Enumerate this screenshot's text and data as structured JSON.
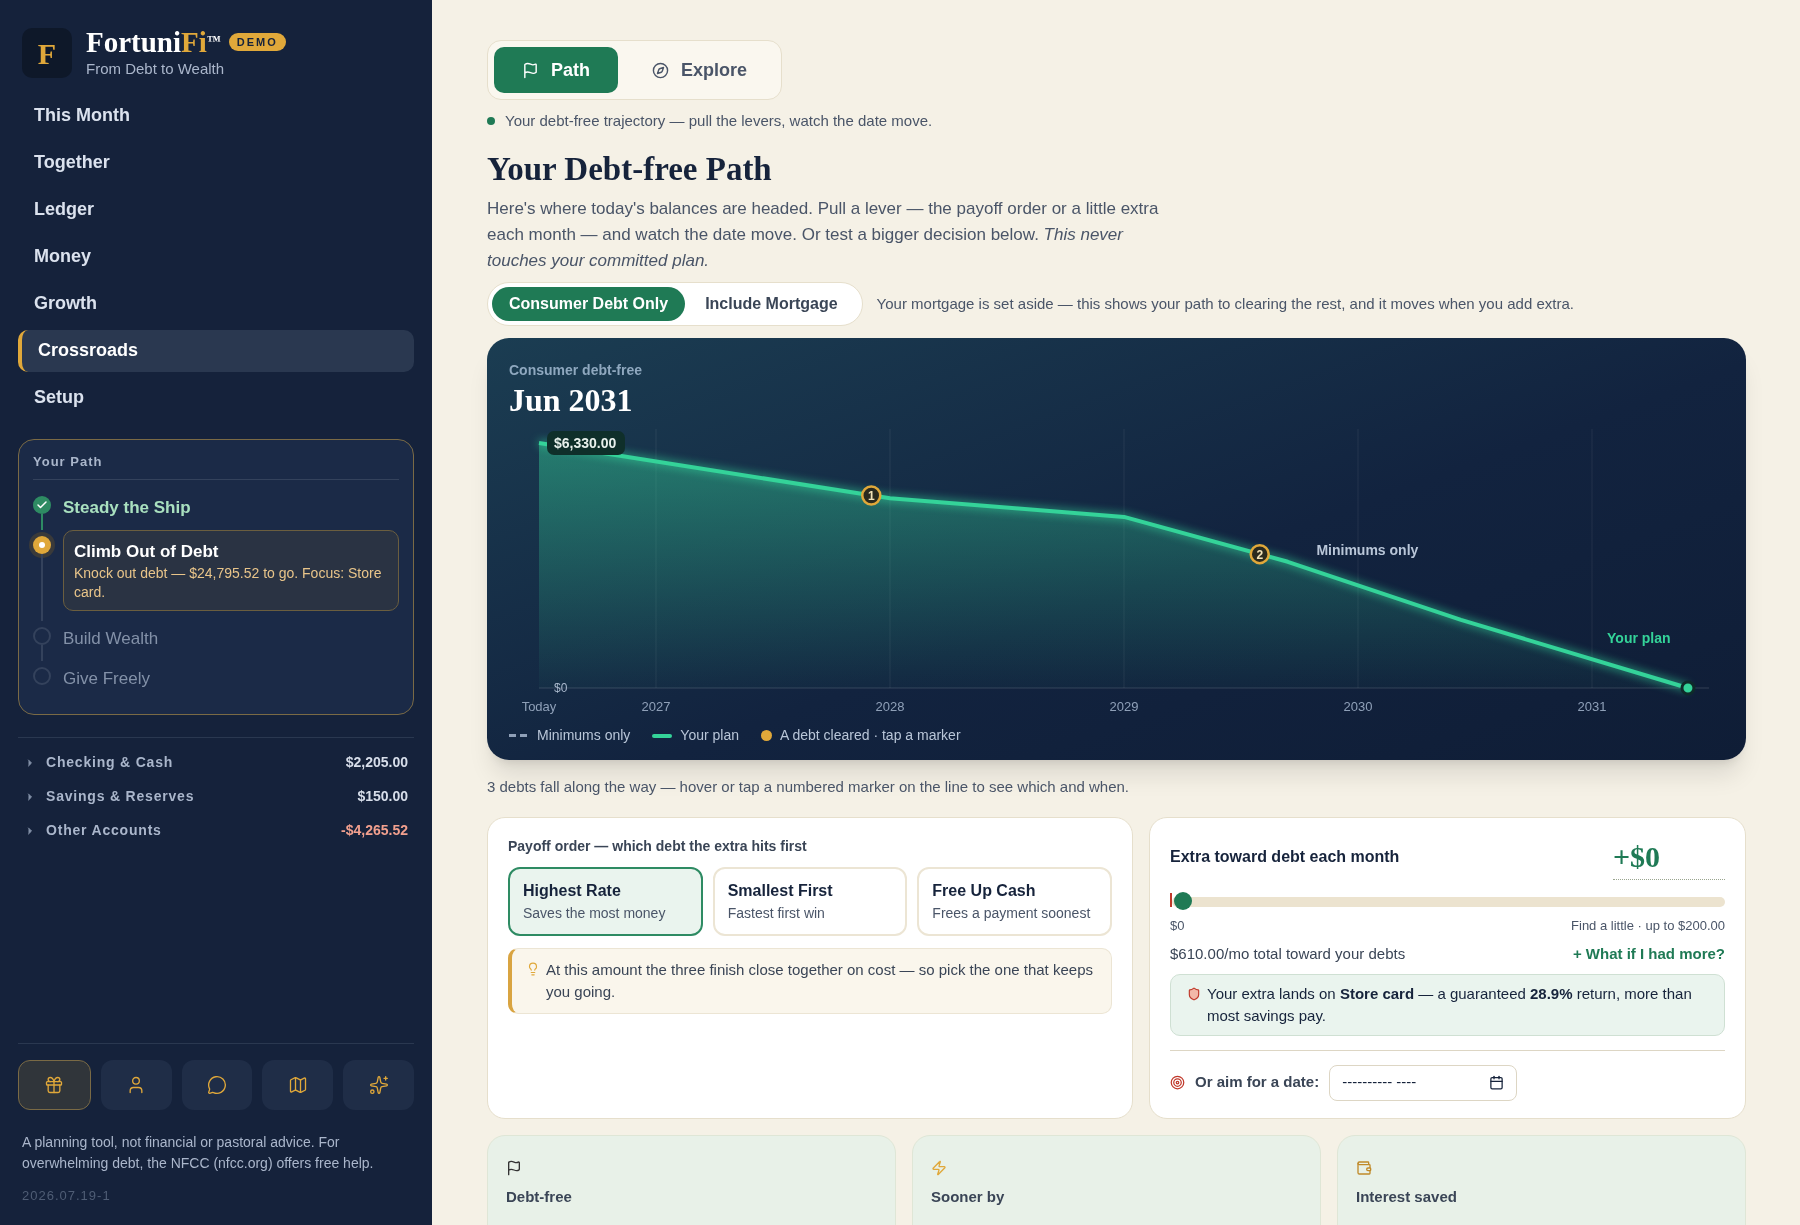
{
  "brand": {
    "name_start": "Fortuni",
    "name_accent": "Fi",
    "trademark": "™",
    "badge": "DEMO",
    "tagline": "From Debt to Wealth",
    "logo_letter": "F"
  },
  "nav": [
    {
      "label": "This Month",
      "selected": false
    },
    {
      "label": "Together",
      "selected": false
    },
    {
      "label": "Ledger",
      "selected": false
    },
    {
      "label": "Money",
      "selected": false
    },
    {
      "label": "Growth",
      "selected": false
    },
    {
      "label": "Crossroads",
      "selected": true
    },
    {
      "label": "Setup",
      "selected": false
    }
  ],
  "path_panel": {
    "title": "Your Path",
    "steps": [
      {
        "label": "Steady the Ship",
        "kind": "done"
      },
      {
        "label": "Climb Out of Debt",
        "kind": "current",
        "detail": "Knock out debt — $24,795.52 to go. Focus: Store card."
      },
      {
        "label": "Build Wealth",
        "kind": "upcoming"
      },
      {
        "label": "Give Freely",
        "kind": "upcoming"
      }
    ]
  },
  "accounts": [
    {
      "name": "Checking & Cash",
      "amount": "$2,205.00",
      "negative": false,
      "expanded": false
    },
    {
      "name": "Savings & Reserves",
      "amount": "$150.00",
      "negative": false,
      "expanded": false
    },
    {
      "name": "Other Accounts",
      "amount": "-$4,265.52",
      "negative": true,
      "expanded": false
    }
  ],
  "tool_buttons": [
    {
      "kind": "gift",
      "selected": true
    },
    {
      "kind": "person",
      "selected": false
    },
    {
      "kind": "chat",
      "selected": false
    },
    {
      "kind": "map",
      "selected": false
    },
    {
      "kind": "sparkles",
      "selected": false
    }
  ],
  "disclaimer": "A planning tool, not financial or pastoral advice. For overwhelming debt, the NFCC (nfcc.org) offers free help.",
  "version": "2026.07.19-1",
  "mode_tabs": [
    {
      "label": "Path",
      "kind": "flag",
      "selected": true
    },
    {
      "label": "Explore",
      "kind": "compass",
      "selected": false
    }
  ],
  "status_line": "Your debt-free trajectory — pull the levers, watch the date move.",
  "heading": "Your Debt-free Path",
  "intro": "Here's where today's balances are headed. Pull a lever — the payoff order or a little extra each month — and watch the date move. Or test a bigger decision below. *This never touches your committed plan.*",
  "scope_toggle": [
    {
      "label": "Consumer Debt Only",
      "selected": true
    },
    {
      "label": "Include Mortgage",
      "selected": false
    }
  ],
  "scope_note": "Your mortgage is set aside — this shows your path to clearing the rest, and it moves when you add extra.",
  "chart_card": {
    "caption": "Consumer debt-free",
    "date": "Jun 2031",
    "chart_data": {
      "type": "area",
      "grid": true,
      "x": [
        2026.5,
        2028,
        2029,
        2029.7,
        2030.44,
        2031.41
      ],
      "series": [
        {
          "name": "Your plan",
          "color": "#34d399",
          "values": [
            6330,
            4900,
            4420,
            3260,
            1760,
            0
          ]
        }
      ],
      "xlim": [
        2026.5,
        2031.5
      ],
      "ylim": [
        0,
        6330
      ],
      "yticks": [
        {
          "value": 0,
          "label": "$0"
        },
        {
          "value": 6330,
          "label": "$6,330.00"
        }
      ],
      "xticks": [
        {
          "value": 2026.5,
          "label": "Today"
        },
        {
          "value": 2027,
          "label": "2027"
        },
        {
          "value": 2028,
          "label": "2028"
        },
        {
          "value": 2029,
          "label": "2029"
        },
        {
          "value": 2030,
          "label": "2030"
        },
        {
          "value": 2031,
          "label": "2031"
        }
      ],
      "annotations": [
        "1",
        "2",
        "Minimums only"
      ]
    },
    "legend": [
      {
        "kind": "dashed",
        "label": "Minimums only"
      },
      {
        "kind": "line",
        "label": "Your plan"
      },
      {
        "kind": "dot",
        "label": "A debt cleared · tap a marker"
      }
    ]
  },
  "chart_note": "3 debts fall along the way — hover or tap a numbered marker on the line to see which and when.",
  "payoff": {
    "title": "Payoff order — which debt the extra hits first",
    "options": [
      {
        "label": "Highest Rate",
        "sub": "Saves the most money",
        "selected": true
      },
      {
        "label": "Smallest First",
        "sub": "Fastest first win",
        "selected": false
      },
      {
        "label": "Free Up Cash",
        "sub": "Frees a payment soonest",
        "selected": false
      }
    ],
    "tip": "At this amount the three finish close together on cost — so pick the one that keeps you going."
  },
  "extra": {
    "title": "Extra toward debt each month",
    "amount": "+$0",
    "level": 0,
    "min_label": "$0",
    "max_label": "Find a little · up to $200.00",
    "total": "$610.00/mo total toward your debts",
    "more_link": "+ What if I had more?",
    "insight": "Your extra lands on **Store card** — a guaranteed **28.9%** return, more than most savings pay.",
    "date_label": "Or aim for a date:",
    "date_value": "---------- ----"
  },
  "stats": [
    {
      "kind": "flag",
      "label": "Debt-free"
    },
    {
      "kind": "bolt",
      "label": "Sooner by"
    },
    {
      "kind": "bag",
      "label": "Interest saved"
    }
  ]
}
